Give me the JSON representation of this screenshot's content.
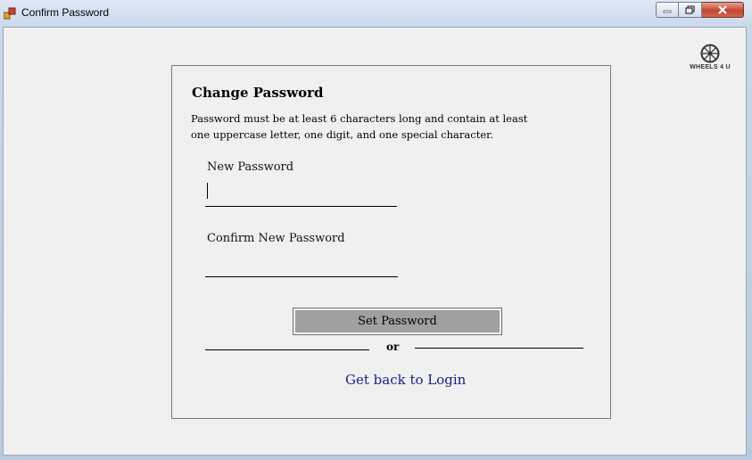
{
  "window": {
    "title": "Confirm Password",
    "controls": [
      "minimize-icon",
      "maximize-icon",
      "close-icon"
    ]
  },
  "logo": {
    "text": "WHEELS 4 U",
    "icon": "wheel-icon"
  },
  "form": {
    "heading": "Change Password",
    "description": "Password must be at least 6 characters long and contain at least one uppercase letter, one digit, and one special character.",
    "new_password_label": "New Password",
    "new_password_value": "",
    "confirm_password_label": "Confirm New Password",
    "confirm_password_value": "",
    "submit_label": "Set Password",
    "separator_text": "or",
    "back_link": "Get back to Login"
  },
  "colors": {
    "button_fill": "#a0a0a0",
    "link": "#1a1a8c",
    "close_button": "#c3452f"
  }
}
